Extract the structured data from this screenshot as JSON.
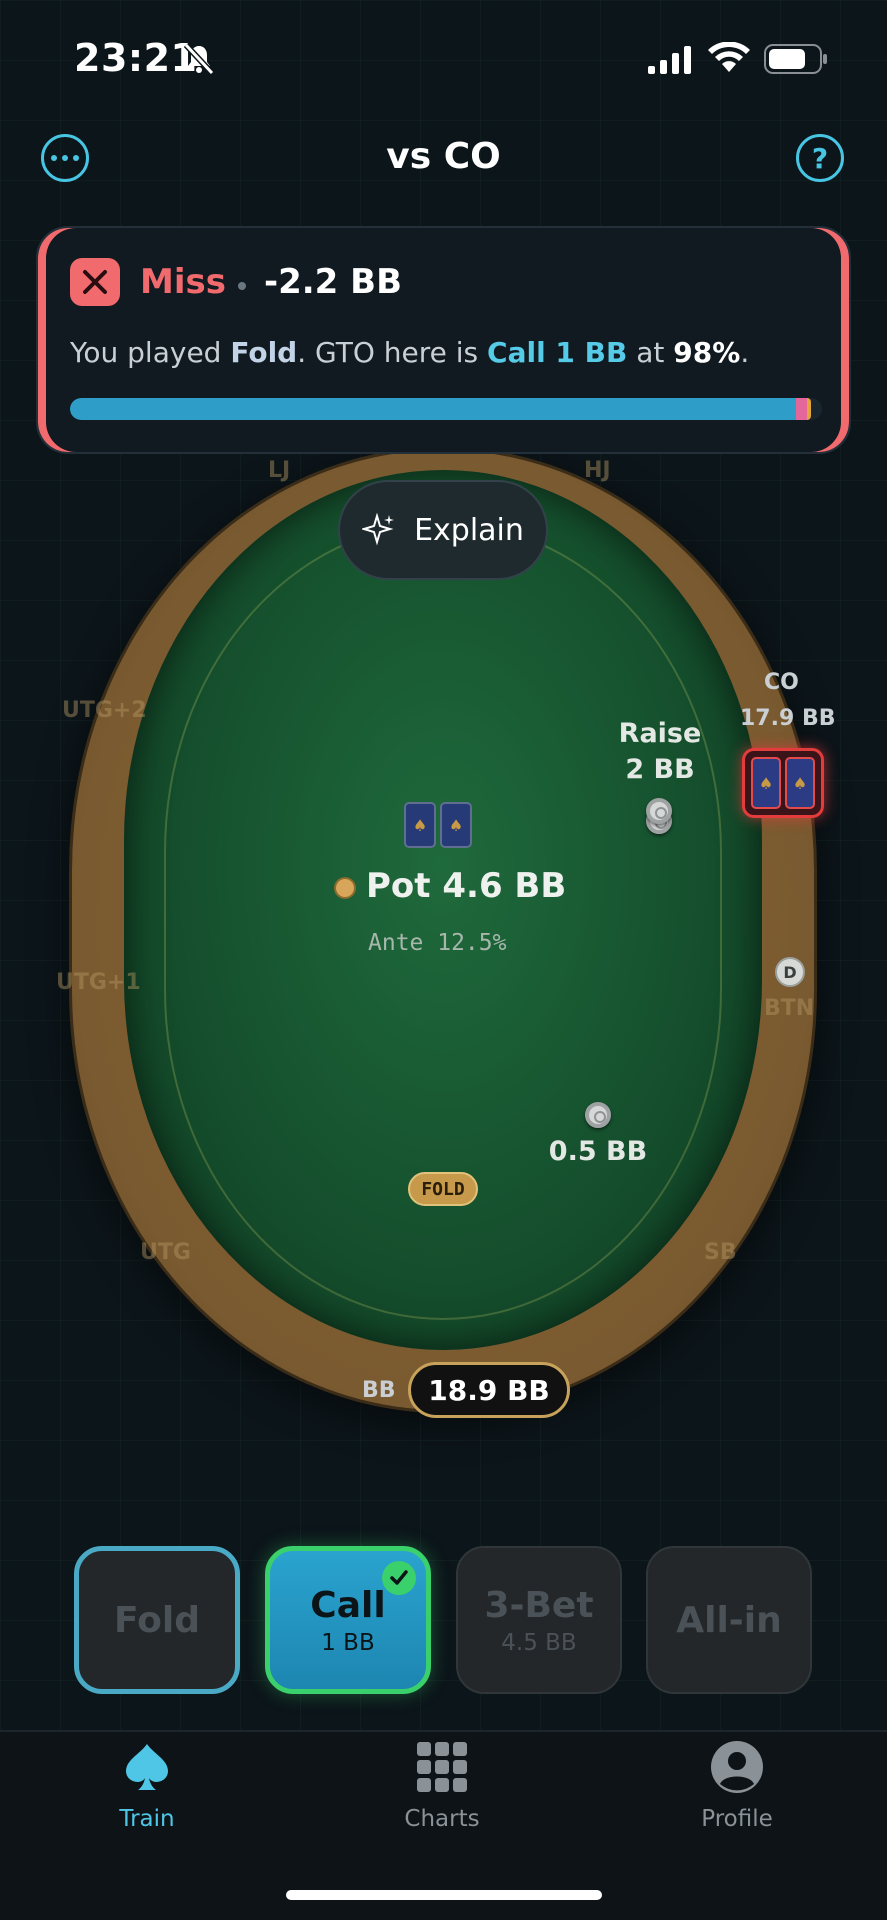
{
  "status_bar": {
    "time": "23:21"
  },
  "header": {
    "title": "vs CO",
    "help_symbol": "?"
  },
  "feedback": {
    "result": "Miss",
    "bb_delta": "-2.2 BB",
    "text_prefix": "You played ",
    "played_action": "Fold",
    "text_mid": ". GTO here is ",
    "gto_action": "Call 1 BB",
    "text_at": " at ",
    "gto_frequency": "98%",
    "text_end": ".",
    "frequency_bar": {
      "call": 0.965,
      "raise": 0.015,
      "allin": 0.006
    },
    "colors": {
      "miss": "#f06a6e",
      "call": "#2e9ec9",
      "raise": "#e3679a",
      "allin": "#e6a53c"
    }
  },
  "table": {
    "explain_label": "Explain",
    "seats": {
      "lj": "LJ",
      "hj": "HJ",
      "co": "CO",
      "btn": "BTN",
      "sb": "SB",
      "bb": "BB",
      "utg": "UTG",
      "utg1": "UTG+1",
      "utg2": "UTG+2"
    },
    "co_stack": "17.9 BB",
    "raise_label": "Raise",
    "raise_amount": "2 BB",
    "pot": "Pot 4.6 BB",
    "ante": "Ante 12.5%",
    "sb_bet": "0.5 BB",
    "fold_badge": "FOLD",
    "dealer_button": "D",
    "hero_stack": "18.9 BB",
    "card_suit": "♠"
  },
  "actions": [
    {
      "label": "Fold",
      "sub": ""
    },
    {
      "label": "Call",
      "sub": "1 BB"
    },
    {
      "label": "3-Bet",
      "sub": "4.5 BB"
    },
    {
      "label": "All-in",
      "sub": ""
    }
  ],
  "tabs": [
    {
      "label": "Train",
      "icon": "spade-icon",
      "active": true
    },
    {
      "label": "Charts",
      "icon": "grid-icon",
      "active": false
    },
    {
      "label": "Profile",
      "icon": "person-icon",
      "active": false
    }
  ]
}
